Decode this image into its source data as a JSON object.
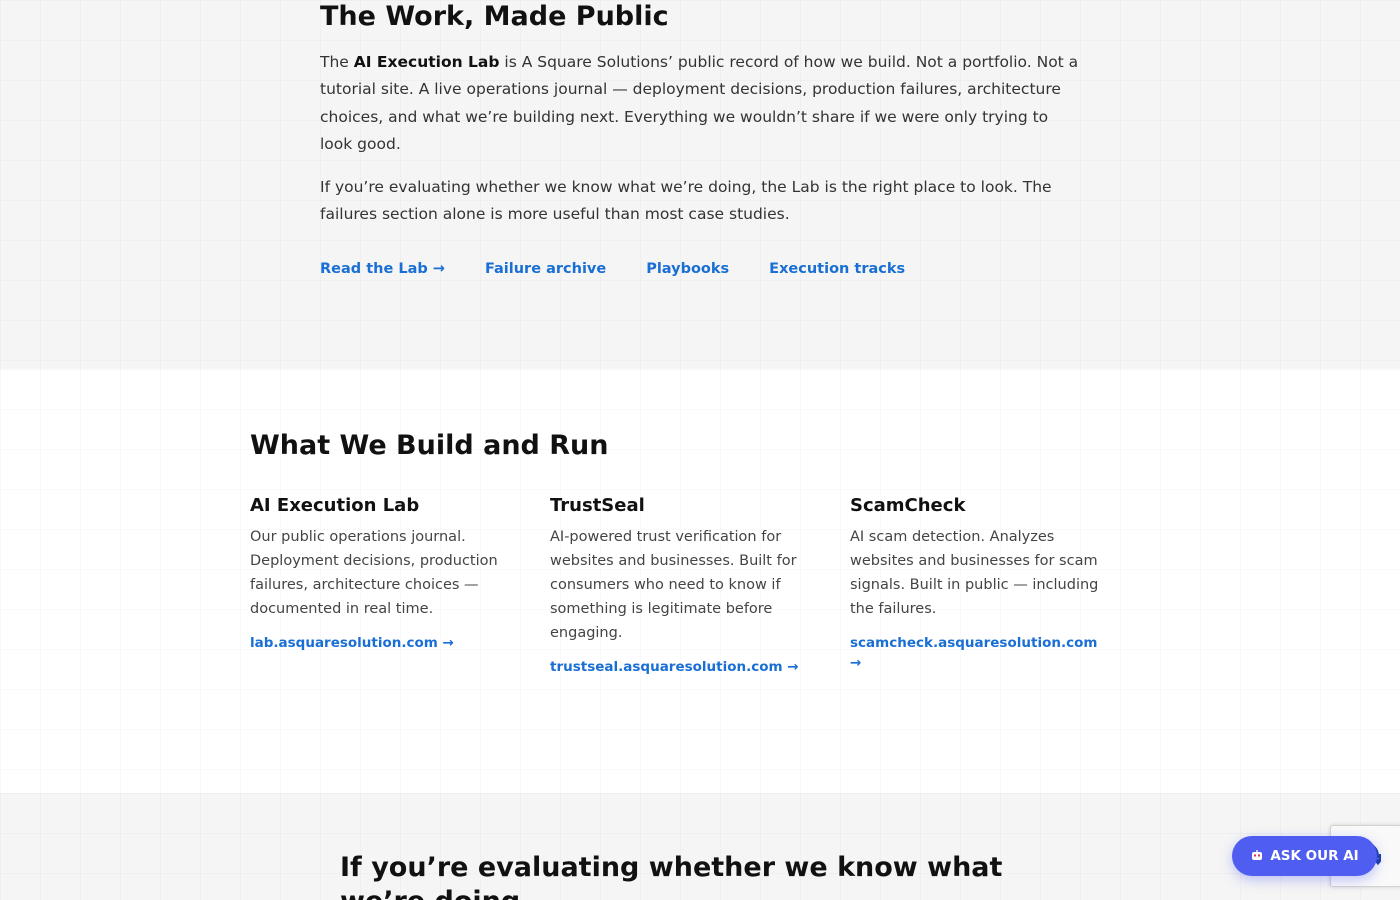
{
  "intro": {
    "heading": "The Work, Made Public",
    "para1": {
      "prefix": "The ",
      "bold": "AI Execution Lab",
      "suffix": " is A Square Solutions’ public record of how we build. Not a portfolio. Not a tutorial site. A live operations journal — deployment decisions, production failures, architecture choices, and what we’re building next. Everything we wouldn’t share if we were only trying to look good."
    },
    "para2": "If you’re evaluating whether we know what we’re doing, the Lab is the right place to look. The failures section alone is more useful than most case studies.",
    "links": [
      {
        "label": "Read the Lab →"
      },
      {
        "label": "Failure archive"
      },
      {
        "label": "Playbooks"
      },
      {
        "label": "Execution tracks"
      }
    ]
  },
  "build": {
    "heading": "What We Build and Run",
    "cards": [
      {
        "title": "AI Execution Lab",
        "desc": "Our public operations journal. Deployment decisions, production failures, architecture choices — documented in real time.",
        "link": "lab.asquaresolution.com →"
      },
      {
        "title": "TrustSeal",
        "desc": "AI-powered trust verification for websites and businesses. Built for consumers who need to know if something is legitimate before engaging.",
        "link": "trustseal.asquaresolution.com →"
      },
      {
        "title": "ScamCheck",
        "desc": "AI scam detection. Analyzes websites and businesses for scam signals. Built in public — including the failures.",
        "link": "scamcheck.asquaresolution.com →"
      }
    ]
  },
  "evaluate": {
    "heading": "If you’re evaluating whether we know what we’re doing..."
  },
  "chat_widget": {
    "label": "ASK OUR AI",
    "icon": "robot-icon",
    "color": "#4f5ef0"
  },
  "colors": {
    "link": "#1a6fd4",
    "section_alt": "#f5f5f5"
  }
}
